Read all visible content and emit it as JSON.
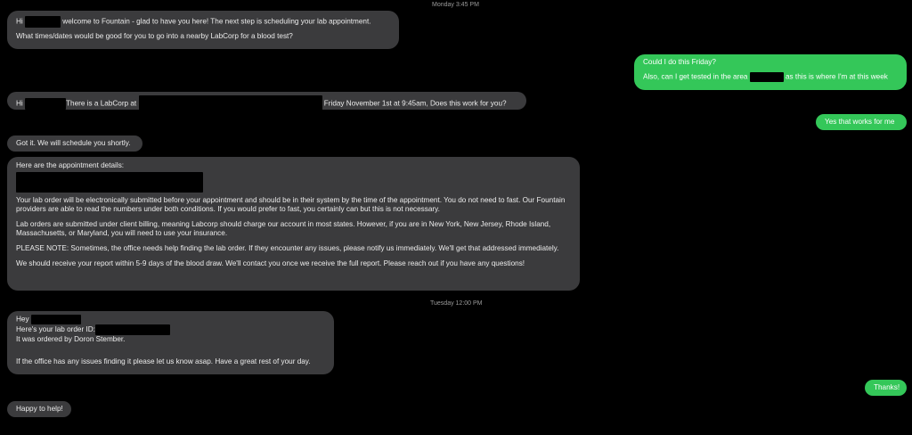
{
  "timestamps": {
    "top": "Monday 3:45 PM",
    "middle": "Tuesday 12:00 PM"
  },
  "messages": {
    "m1": {
      "line1_pre": "Hi",
      "line1_post": "welcome to Fountain - glad to have you here! The next step is scheduling your lab appointment.",
      "line2": "What times/dates would be good for you to go into a nearby LabCorp for a blood test?"
    },
    "m2": {
      "line1": "Could I do this Friday?",
      "line2_pre": "Also, can I get tested in the area",
      "line2_post": "as this is where I'm at this week"
    },
    "m3": {
      "pre": "Hi",
      "mid": "There is a LabCorp at",
      "post": "Friday November 1st at 9:45am, Does this work for you?"
    },
    "m4": {
      "text": "Yes that works for me"
    },
    "m5": {
      "text": "Got it. We will schedule you shortly."
    },
    "m6": {
      "header": "Here are the appointment details:",
      "p1": "Your lab order will be electronically submitted before your appointment and should be in their system by the time of the appointment. You do not need to fast. Our Fountain providers are able to read the numbers under both conditions. If you would prefer to fast, you certainly can but this is not necessary.",
      "p2": "Lab orders are submitted under client billing, meaning Labcorp should charge our account in most states. However, if you are in New York, New Jersey, Rhode Island, Massachusetts, or Maryland, you will need to use your insurance.",
      "p3": "PLEASE NOTE: Sometimes, the office needs help finding the lab order. If they encounter any issues, please notify us immediately. We'll get that addressed immediately.",
      "p4": "We should receive your report within 5-9 days of the blood draw. We'll contact you once we receive the full report. Please reach out if you have any questions!"
    },
    "m7": {
      "line1": "Hey",
      "line2": "Here's your lab order ID:",
      "line3": "It was ordered by Doron Stember.",
      "line4": "If the office has any issues finding it please let us know asap. Have a great rest of your day."
    },
    "m8": {
      "text": "Thanks!"
    },
    "m9": {
      "text": "Happy to help!"
    }
  },
  "colors": {
    "incoming": "#3b3b3d",
    "outgoing": "#34c759",
    "background": "#000000"
  }
}
